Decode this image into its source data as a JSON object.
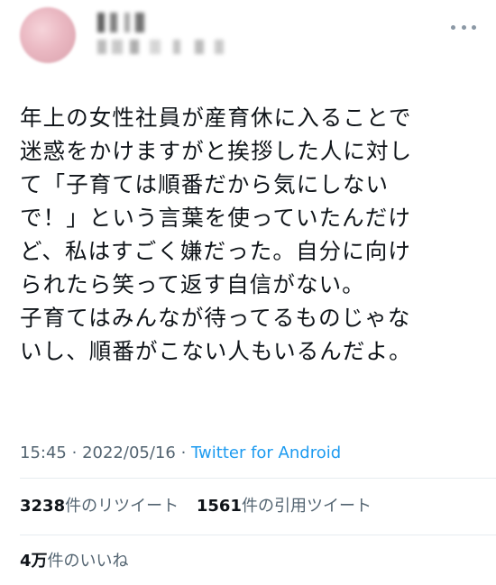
{
  "tweet": {
    "body_lines": [
      "年上の女性社員が産育休に入ることで",
      "迷惑をかけますがと挨拶した人に対し",
      "て「子育ては順番だから気にしない",
      "で！」という言葉を使っていたんだけ",
      "ど、私はすごく嫌だった。自分に向け",
      "られたら笑って返す自信がない。",
      "子育てはみんなが待ってるものじゃな",
      "いし、順番がこない人もいるんだよ。"
    ],
    "time": "15:45",
    "separator": "·",
    "date": "2022/05/16",
    "source": "Twitter for Android"
  },
  "stats": {
    "retweets_count": "3238",
    "retweets_label": "件のリツイート",
    "quotes_count": "1561",
    "quotes_label": "件の引用ツイート",
    "likes_count": "4万",
    "likes_label": "件のいいね"
  },
  "icons": {
    "more": "more-horizontal-icon"
  },
  "colors": {
    "text": "#0f1419",
    "secondary": "#536471",
    "link": "#1d9bf0",
    "divider": "#e6ecf0"
  }
}
